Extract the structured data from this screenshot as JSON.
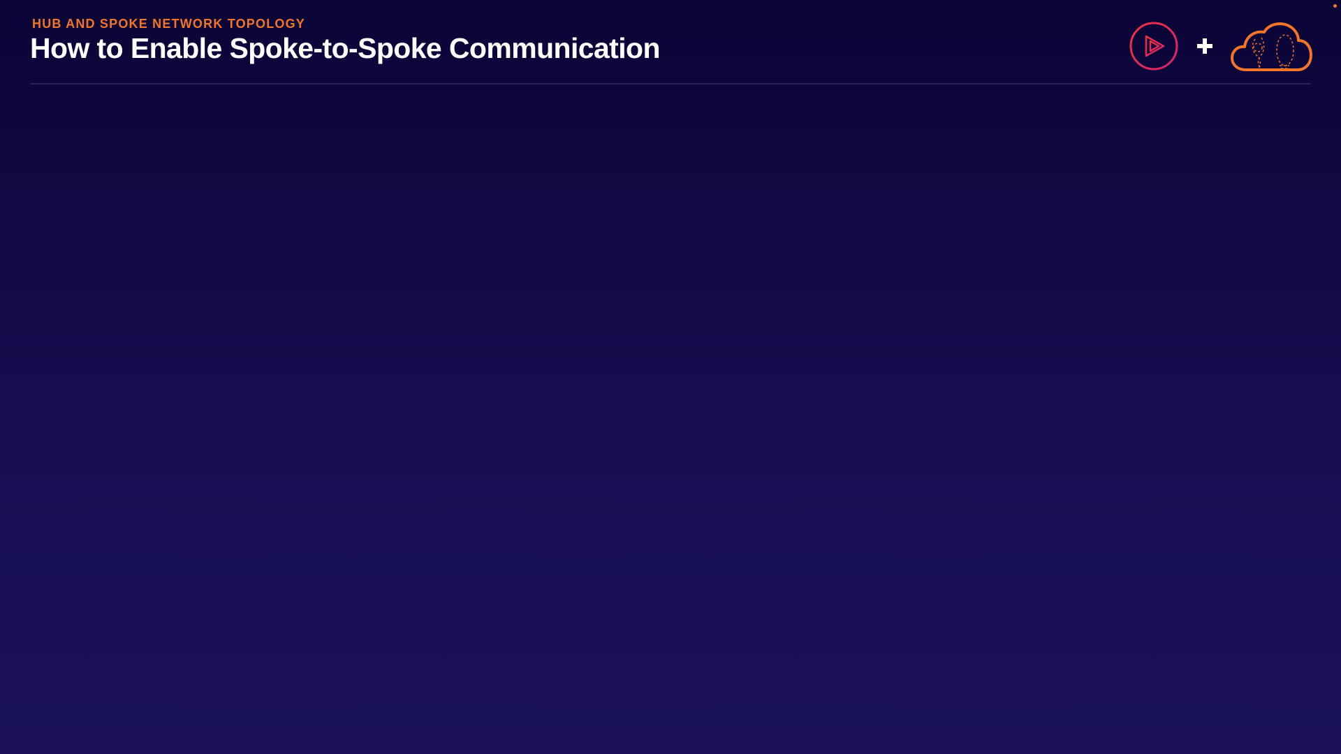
{
  "header": {
    "kicker": "HUB AND SPOKE NETWORK TOPOLOGY",
    "title": "How to Enable Spoke-to-Spoke Communication"
  },
  "branding": {
    "left_logo": "play-logo-icon",
    "separator": "plus-icon",
    "right_logo": "cloud-logo-icon"
  },
  "colors": {
    "accent_orange": "#f2752a",
    "accent_pink": "#e8355a",
    "title_white": "#ffffff",
    "background_top": "#0a0436",
    "background_bottom": "#1b1259",
    "divider": "#2a2460"
  }
}
